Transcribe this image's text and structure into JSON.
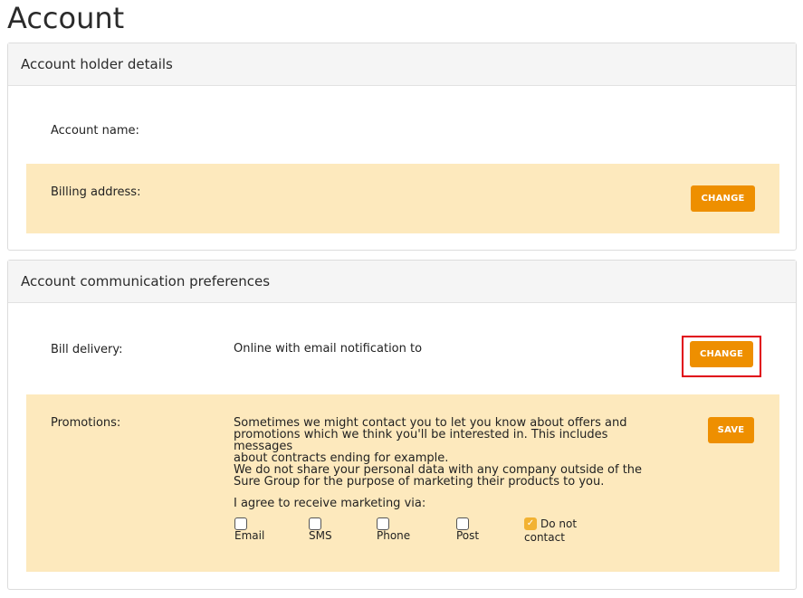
{
  "page": {
    "title": "Account"
  },
  "account_holder": {
    "heading": "Account holder details",
    "account_name_label": "Account name:",
    "billing_address_label": "Billing address:",
    "change_label": "CHANGE"
  },
  "communication": {
    "heading": "Account communication preferences",
    "bill_delivery_label": "Bill delivery:",
    "bill_delivery_value": "Online with email notification to",
    "change_label": "CHANGE",
    "promotions_label": "Promotions:",
    "promotions_text": [
      "Sometimes we might contact you to let you know about offers and",
      "promotions which we think you'll be interested in. This includes messages",
      "about contracts ending for example.",
      "We do not share your personal data with any company outside of the",
      "Sure Group for the purpose of marketing their products to you."
    ],
    "agree_text": "I agree to receive marketing via:",
    "save_label": "SAVE",
    "options": [
      {
        "label": "Email",
        "checked": false
      },
      {
        "label": "SMS",
        "checked": false
      },
      {
        "label": "Phone",
        "checked": false
      },
      {
        "label": "Post",
        "checked": false
      },
      {
        "label_line1": "Do not",
        "label_line2": "contact",
        "checked": true
      }
    ]
  },
  "colors": {
    "accent": "#ee8f00",
    "highlight_row": "#fde9bd",
    "focus_outline": "#e00012"
  }
}
